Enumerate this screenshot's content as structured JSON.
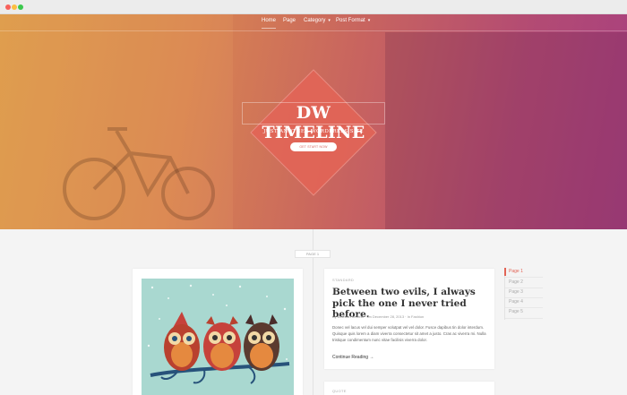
{
  "nav": {
    "items": [
      {
        "label": "Home",
        "active": true,
        "dropdown": false
      },
      {
        "label": "Page",
        "active": false,
        "dropdown": false
      },
      {
        "label": "Category",
        "active": false,
        "dropdown": true
      },
      {
        "label": "Post Format",
        "active": false,
        "dropdown": true
      }
    ]
  },
  "hero": {
    "title": "DW TIMELINE",
    "tagline": "JUST ANOTHER WORDPRESS SITE",
    "button_label": "GET START NOW"
  },
  "timeline": {
    "page_marker": "PAGE 1"
  },
  "posts": [
    {
      "format": "STANDARD",
      "title": "Between two evils, I always pick the one I never tried before.",
      "meta": "By Belinda Redfield  ·  On December 28, 2013  ·  In Fashion",
      "excerpt": "Donec vel lacus vel dui semper volutpat vel vel dolor. Fusce dapibus tin dolor interdum. Quisque quis lorem a diam viverra consectetur sit amet a justo. Cras ac viverra mi. Nulla tristique condimentum nunc vitae facilisis viverra dolor.",
      "continue_label": "Continue Reading →"
    },
    {
      "format": "QUOTE"
    }
  ],
  "pagination": {
    "items": [
      "Page 1",
      "Page 2",
      "Page 3",
      "Page 4",
      "Page 5"
    ],
    "active_index": 0
  },
  "colors": {
    "accent": "#e26456",
    "hero_start": "#dc9a4a",
    "hero_end": "#a8407f"
  }
}
